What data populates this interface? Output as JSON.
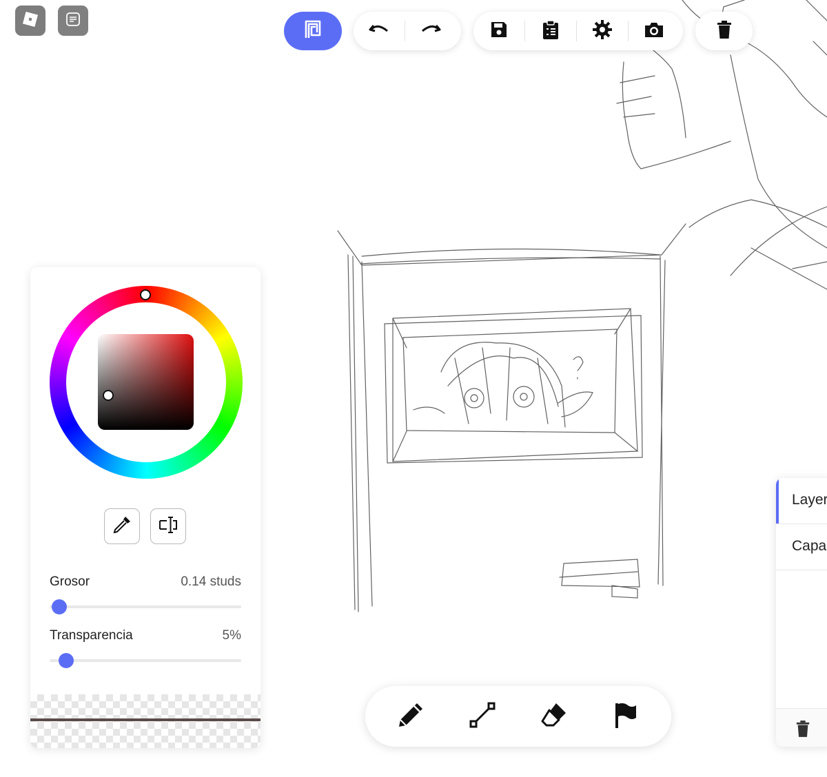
{
  "toolbar": {
    "brand_icon": "canvas-logo-icon",
    "undo_icon": "undo-icon",
    "redo_icon": "redo-icon",
    "save_icon": "save-icon",
    "clipboard_icon": "clipboard-list-icon",
    "settings_icon": "gear-icon",
    "camera_icon": "camera-icon",
    "delete_icon": "trash-icon",
    "accent_color": "#5c6df5"
  },
  "color_panel": {
    "hue_knob_color": "#e01010",
    "tools": [
      "eyedropper-icon",
      "text-cursor-icon"
    ],
    "thickness": {
      "label": "Grosor",
      "value": "0.14 studs",
      "fraction": 0.01
    },
    "transparency": {
      "label": "Transparencia",
      "value": "5%",
      "fraction": 0.05
    },
    "stroke_preview_color": "#5a4a4a"
  },
  "bottom_tools": [
    "pencil-icon",
    "line-icon",
    "eraser-icon",
    "flag-icon"
  ],
  "layers": {
    "items": [
      {
        "label": "Layer"
      },
      {
        "label": "Capa"
      }
    ],
    "footer_icon": "trash-icon"
  }
}
